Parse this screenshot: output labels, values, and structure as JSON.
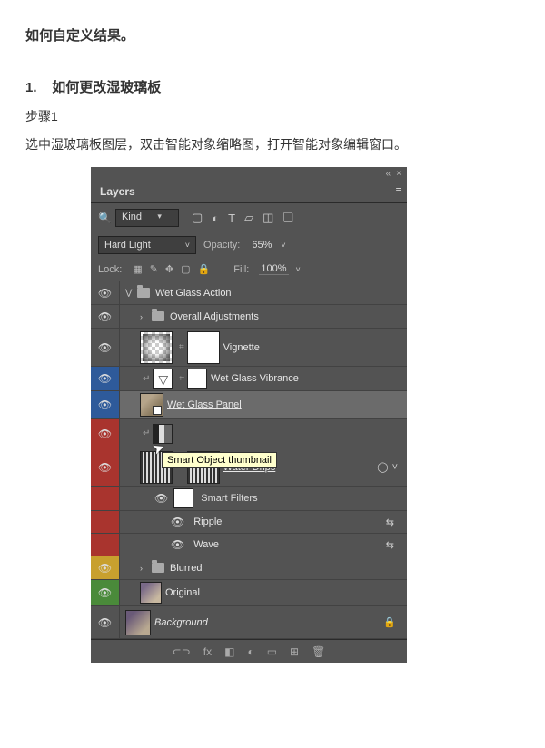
{
  "doc": {
    "intro": "如何自定义结果。",
    "section_num": "1.",
    "section_title": "如何更改湿玻璃板",
    "step_label": "步骤1",
    "step_text": "选中湿玻璃板图层，双击智能对象缩略图，打开智能对象编辑窗口。"
  },
  "panel": {
    "tab": "Layers",
    "close_glyph": "×",
    "collapse_glyph": "«",
    "menu_glyph": "≡",
    "filter": {
      "search_glyph": "🔍",
      "kind": "Kind",
      "chev": "▾",
      "icons": {
        "img": "▢",
        "adj": "◐",
        "type": "T",
        "shape": "▱",
        "smart": "◫",
        "filter": "❏"
      }
    },
    "blend": {
      "mode": "Hard Light",
      "chev": "˅",
      "opacity_label": "Opacity:",
      "opacity_value": "65%"
    },
    "lock": {
      "label": "Lock:",
      "trans": "▦",
      "paint": "✎",
      "arrows": "✥",
      "frame": "▢",
      "pad": "🔒",
      "fill_label": "Fill:",
      "fill_value": "100%"
    },
    "tooltip": "Smart Object thumbnail",
    "layers": {
      "group": "Wet Glass Action",
      "overall": "Overall Adjustments",
      "vignette": "Vignette",
      "vibrance": "Wet Glass Vibrance",
      "panel_layer": "Wet Glass Panel ",
      "drips": "Water Drips ",
      "smart_filters": "Smart Filters",
      "ripple": "Ripple",
      "wave": "Wave",
      "blurred": "Blurred",
      "original": "Original",
      "background": "Background"
    },
    "glyphs": {
      "eye": "👁",
      "twisty_open": "⋁",
      "twisty_closed": "›",
      "link": "⌗",
      "clip": "↵",
      "fx": "fx",
      "fx_chev": "˅",
      "filter_edit": "⇆",
      "lock": "🔒",
      "circle": "◯"
    },
    "footer": {
      "link": "⊂⊃",
      "fx": "fx",
      "mask": "◧",
      "adj": "◐",
      "group": "▭",
      "new": "⊞",
      "trash": "🗑"
    }
  }
}
